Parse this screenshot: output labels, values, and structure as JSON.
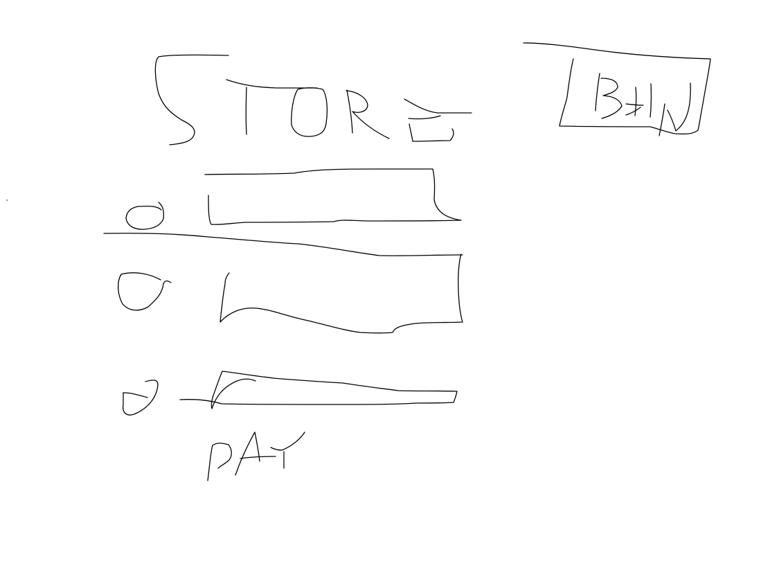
{
  "sketch": {
    "stroke_color": "#000000",
    "background_color": "#ffffff",
    "title_text": "STORE",
    "bag_button_text": "BAG",
    "pay_text": "PAY"
  },
  "items": [
    {
      "icon": "radio-circle-icon"
    },
    {
      "icon": "radio-circle-icon"
    },
    {
      "icon": "radio-circle-icon"
    }
  ]
}
